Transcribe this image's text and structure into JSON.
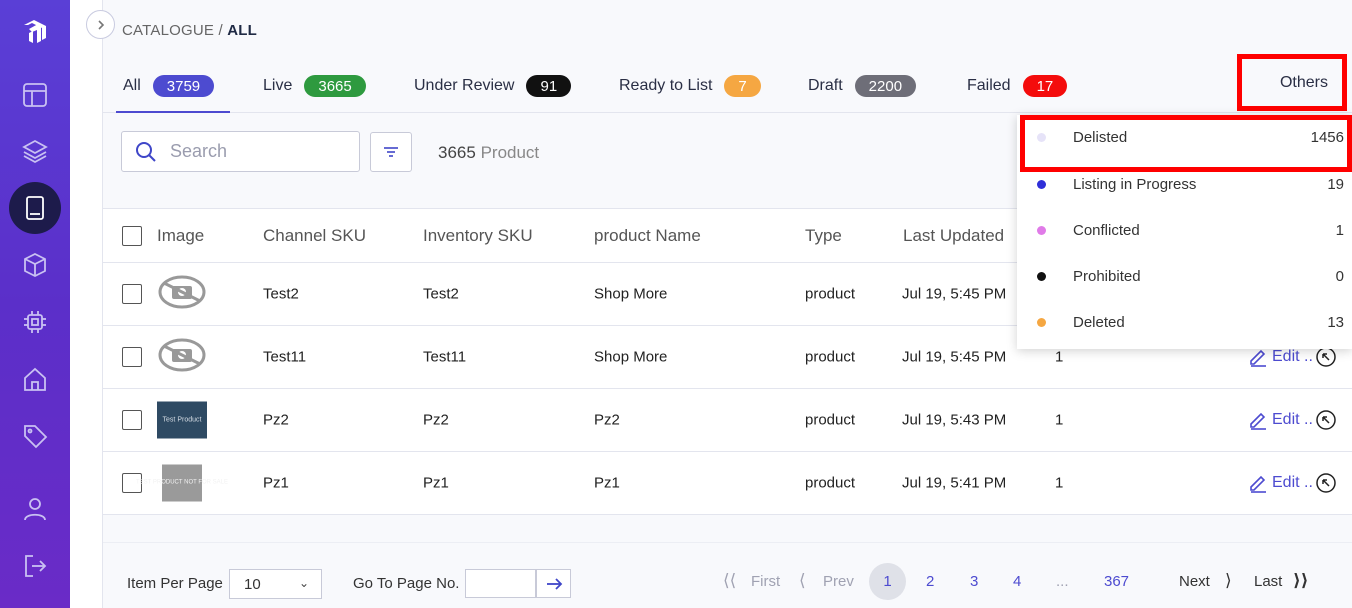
{
  "breadcrumb": {
    "root": "CATALOGUE",
    "separator": " / ",
    "current": "ALL"
  },
  "tabs": [
    {
      "label": "All",
      "count": "3759",
      "color": "#4d4bd0"
    },
    {
      "label": "Live",
      "count": "3665",
      "color": "#2e9a3f"
    },
    {
      "label": "Under Review",
      "count": "91",
      "color": "#111111"
    },
    {
      "label": "Ready to List",
      "count": "7",
      "color": "#f5a742"
    },
    {
      "label": "Draft",
      "count": "2200",
      "color": "#6e6e78"
    },
    {
      "label": "Failed",
      "count": "17",
      "color": "#f40c0c"
    }
  ],
  "others_label": "Others",
  "search": {
    "placeholder": "Search"
  },
  "product_count": {
    "number": "3665",
    "unit": "Product"
  },
  "table": {
    "headers": [
      "Image",
      "Channel SKU",
      "Inventory SKU",
      "product Name",
      "Type",
      "Last Updated"
    ],
    "rows": [
      {
        "image": "no-image",
        "channel_sku": "Test2",
        "inventory_sku": "Test2",
        "name": "Shop More",
        "type": "product",
        "updated": "Jul 19, 5:45 PM",
        "qty": "",
        "action": ""
      },
      {
        "image": "no-image",
        "channel_sku": "Test11",
        "inventory_sku": "Test11",
        "name": "Shop More",
        "type": "product",
        "updated": "Jul 19, 5:45 PM",
        "qty": "1",
        "action": "Edit .."
      },
      {
        "image": "Test Product",
        "channel_sku": "Pz2",
        "inventory_sku": "Pz2",
        "name": "Pz2",
        "type": "product",
        "updated": "Jul 19, 5:43 PM",
        "qty": "1",
        "action": "Edit .."
      },
      {
        "image": "TEST PRODUCT NOT FOR SALE",
        "channel_sku": "Pz1",
        "inventory_sku": "Pz1",
        "name": "Pz1",
        "type": "product",
        "updated": "Jul 19, 5:41 PM",
        "qty": "1",
        "action": "Edit .."
      }
    ]
  },
  "others_menu": [
    {
      "label": "Delisted",
      "count": "1456",
      "color": "#e6e3f8"
    },
    {
      "label": "Listing in Progress",
      "count": "19",
      "color": "#2f2fd8"
    },
    {
      "label": "Conflicted",
      "count": "1",
      "color": "#e07be8"
    },
    {
      "label": "Prohibited",
      "count": "0",
      "color": "#111111"
    },
    {
      "label": "Deleted",
      "count": "13",
      "color": "#f5a742"
    }
  ],
  "footer": {
    "per_page_label": "Item Per Page",
    "per_page_value": "10",
    "goto_label": "Go To Page No.",
    "first": "First",
    "prev": "Prev",
    "pages": [
      "1",
      "2",
      "3",
      "4",
      "...",
      "367"
    ],
    "next": "Next",
    "last": "Last"
  }
}
